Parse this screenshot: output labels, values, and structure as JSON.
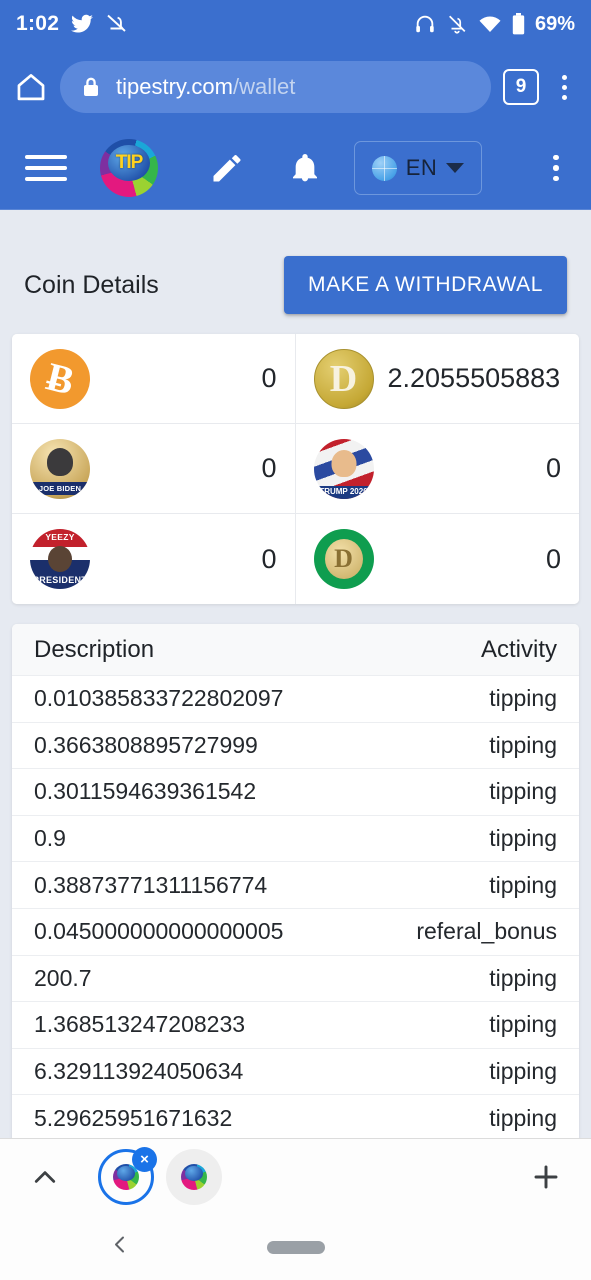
{
  "status_bar": {
    "time": "1:02",
    "battery": "69%",
    "left_icons": [
      "twitter-icon",
      "notifications-muted-icon"
    ],
    "right_icons": [
      "headphones-icon",
      "bell-off-icon",
      "wifi-icon",
      "battery-icon"
    ]
  },
  "browser": {
    "home_icon": "home-icon",
    "lock_icon": "lock-icon",
    "url_domain": "tipestry.com",
    "url_path": "/wallet",
    "tab_count": "9",
    "menu_icon": "kebab-menu-icon"
  },
  "app_header": {
    "menu_icon": "hamburger-icon",
    "logo_text": "TIP",
    "edit_icon": "pencil-icon",
    "notification_icon": "bell-icon",
    "language": "EN",
    "language_globe_icon": "globe-icon",
    "language_caret_icon": "chevron-down-icon",
    "overflow_icon": "kebab-menu-icon"
  },
  "main": {
    "section_title": "Coin Details",
    "withdraw_button": "MAKE A WITHDRAWAL",
    "coins": [
      {
        "name": "bitcoin",
        "art": "c-btc",
        "glyph": "Ƀ",
        "balance": "0"
      },
      {
        "name": "dogecoin",
        "art": "c-doge",
        "glyph": "D",
        "balance": "2.2055505883188"
      },
      {
        "name": "joe-biden-coin",
        "art": "c-biden",
        "label": "JOE BIDEN",
        "balance": "0"
      },
      {
        "name": "trump-2020-coin",
        "art": "c-trump",
        "label": "TRUMP 2020",
        "balance": "0"
      },
      {
        "name": "yeezy-president-coin",
        "art": "c-yeezy",
        "label_top": "YEEZY",
        "label_bottom": "PRESIDENT",
        "balance": "0"
      },
      {
        "name": "green-doge-coin",
        "art": "c-gdoge",
        "glyph": "D",
        "balance": "0"
      }
    ],
    "table": {
      "columns": [
        "Description",
        "Activity"
      ],
      "rows": [
        {
          "description": "0.010385833722802097",
          "activity": "tipping"
        },
        {
          "description": "0.3663808895727999",
          "activity": "tipping"
        },
        {
          "description": "0.3011594639361542",
          "activity": "tipping"
        },
        {
          "description": "0.9",
          "activity": "tipping"
        },
        {
          "description": "0.38873771311156774",
          "activity": "tipping"
        },
        {
          "description": "0.045000000000000005",
          "activity": "referal_bonus"
        },
        {
          "description": "200.7",
          "activity": "tipping"
        },
        {
          "description": "1.368513247208233",
          "activity": "tipping"
        },
        {
          "description": "6.329113924050634",
          "activity": "tipping"
        },
        {
          "description": "5.29625951671632",
          "activity": "tipping"
        }
      ]
    }
  },
  "tab_strip": {
    "expand_icon": "chevron-up-icon",
    "close_tab_label": "×",
    "new_tab_icon": "plus-icon"
  },
  "nav_bar": {
    "back_icon": "back-chevron-icon",
    "home_pill_icon": "home-pill-icon"
  },
  "colors": {
    "chrome_blue": "#3b6fce",
    "omnibox_blue": "#5b88db",
    "page_bg": "#e6eaf1",
    "accent_button": "#3a6fce",
    "tab_accent": "#1a73e8"
  }
}
